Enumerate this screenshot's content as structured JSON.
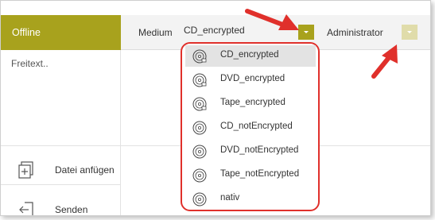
{
  "status": "Offline",
  "toolbar": {
    "medium_label": "Medium",
    "medium_value": "CD_encrypted",
    "user_value": "Administrator"
  },
  "editor": {
    "placeholder": "Freitext.."
  },
  "actions": {
    "attach_label": "Datei anfügen",
    "send_label": "Senden"
  },
  "menu": {
    "items": [
      {
        "label": "CD_encrypted",
        "selected": true,
        "icon": "disc-lock-icon"
      },
      {
        "label": "DVD_encrypted",
        "icon": "disc-lock-icon"
      },
      {
        "label": "Tape_encrypted",
        "icon": "disc-lock-icon"
      },
      {
        "label": "CD_notEncrypted",
        "icon": "disc-icon"
      },
      {
        "label": "DVD_notEncrypted",
        "icon": "disc-icon"
      },
      {
        "label": "Tape_notEncrypted",
        "icon": "disc-icon"
      },
      {
        "label": "nativ",
        "icon": "disc-icon"
      }
    ]
  },
  "colors": {
    "accent": "#a8a21d",
    "accent_light": "#e0dcaa",
    "annotation": "#e0302b"
  }
}
